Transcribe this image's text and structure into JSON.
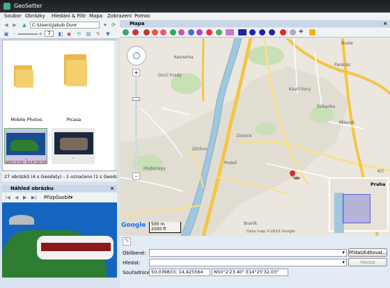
{
  "window": {
    "title": "GeoSetter"
  },
  "menu": [
    "Soubor",
    "Obrázky",
    "Hledání & Filtr",
    "Mapa",
    "Zobrazení",
    "Pomoc"
  ],
  "toolbar": {
    "path": "C:\\Users\\Jakub Dvor",
    "zoom_value": "7"
  },
  "thumbnails": [
    {
      "label": "Mobile Photos"
    },
    {
      "label": "Picasa"
    },
    {
      "label": "-",
      "sub": "N50°2'25\" E14°25'25\""
    },
    {
      "label": "-"
    }
  ],
  "status": {
    "text": "27 obrázků (4 s Geodaty) - 1 označeno (1 s Geodaty), 1 s..."
  },
  "preview": {
    "title": "Náhled obrázku",
    "fit_label": "Přizpůsobit"
  },
  "map": {
    "title": "Mapa",
    "labels": [
      "Kesnerka",
      "Divčí hrady",
      "Zlíchov",
      "Hlubočepy",
      "Dvorce",
      "Kavčí hory",
      "Děkanka",
      "Pankrác",
      "Nusle",
      "Braník",
      "Praha",
      "Krč",
      "Milevsk",
      "Podolí"
    ],
    "scale": {
      "m": "500 m",
      "ft": "2000 ft"
    },
    "copyright": "Data map ©2013 Google"
  },
  "bottom": {
    "favorites_label": "Oblíbené:",
    "search_label": "Hledat:",
    "coords_label": "Souřadnice:",
    "coords_decimal": "50,039833; 14,425564",
    "coords_dms": "N50°2'23.40\" E14°25'32.03\"",
    "btn_favorites": "Přidat/Editovat...",
    "btn_search": "Hledat"
  }
}
